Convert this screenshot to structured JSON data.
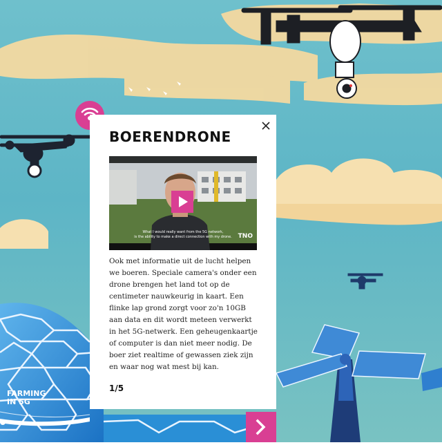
{
  "popup": {
    "title": "BOERENDRONE",
    "body": "Ook met informatie uit de lucht helpen we boeren. Speciale camera's onder een drone brengen het land tot op de centimeter nauwkeurig in kaart. Een flinke lap grond zorgt voor zo'n 10GB aan data en dit wordt meteen verwerkt in het 5G-netwerk. Een geheugenkaartje of computer is dan niet meer nodig. De boer ziet realtime of gewassen ziek zijn en waar nog wat mest bij kan.",
    "page_indicator": "1/5",
    "close_icon": "close-icon"
  },
  "video": {
    "subtitle_line1": "What I would really want from the 5G network,",
    "subtitle_line2": "is the ability to make a direct connection with my drone.",
    "logo": "TNO",
    "play_icon": "play-icon"
  },
  "section_label_line1": "FARMING",
  "section_label_line2": "IN 5G",
  "icons": {
    "wifi": "wifi-icon",
    "next": "chevron-right-icon"
  },
  "colors": {
    "accent": "#d93f93",
    "sky": "#5bb7c8",
    "cloud": "#f5dca0",
    "dome": "#2a8fd6",
    "panel": "#2f7fcf"
  }
}
